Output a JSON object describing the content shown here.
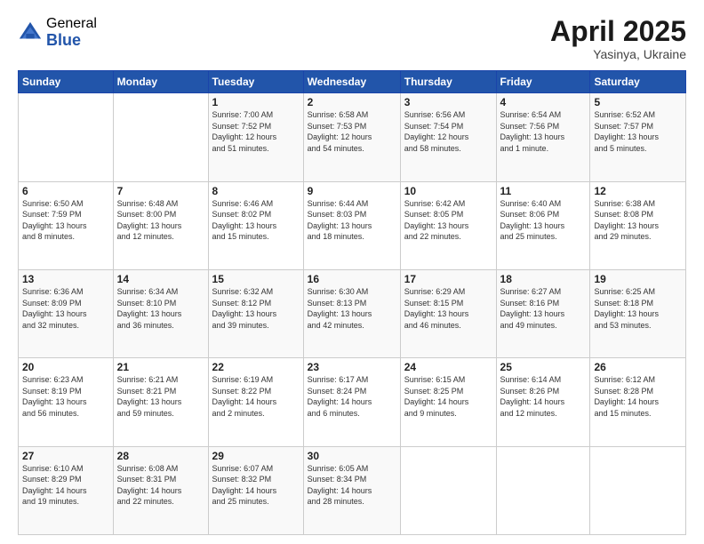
{
  "header": {
    "logo_general": "General",
    "logo_blue": "Blue",
    "month": "April 2025",
    "location": "Yasinya, Ukraine"
  },
  "days_of_week": [
    "Sunday",
    "Monday",
    "Tuesday",
    "Wednesday",
    "Thursday",
    "Friday",
    "Saturday"
  ],
  "weeks": [
    [
      {
        "day": "",
        "info": ""
      },
      {
        "day": "",
        "info": ""
      },
      {
        "day": "1",
        "info": "Sunrise: 7:00 AM\nSunset: 7:52 PM\nDaylight: 12 hours\nand 51 minutes."
      },
      {
        "day": "2",
        "info": "Sunrise: 6:58 AM\nSunset: 7:53 PM\nDaylight: 12 hours\nand 54 minutes."
      },
      {
        "day": "3",
        "info": "Sunrise: 6:56 AM\nSunset: 7:54 PM\nDaylight: 12 hours\nand 58 minutes."
      },
      {
        "day": "4",
        "info": "Sunrise: 6:54 AM\nSunset: 7:56 PM\nDaylight: 13 hours\nand 1 minute."
      },
      {
        "day": "5",
        "info": "Sunrise: 6:52 AM\nSunset: 7:57 PM\nDaylight: 13 hours\nand 5 minutes."
      }
    ],
    [
      {
        "day": "6",
        "info": "Sunrise: 6:50 AM\nSunset: 7:59 PM\nDaylight: 13 hours\nand 8 minutes."
      },
      {
        "day": "7",
        "info": "Sunrise: 6:48 AM\nSunset: 8:00 PM\nDaylight: 13 hours\nand 12 minutes."
      },
      {
        "day": "8",
        "info": "Sunrise: 6:46 AM\nSunset: 8:02 PM\nDaylight: 13 hours\nand 15 minutes."
      },
      {
        "day": "9",
        "info": "Sunrise: 6:44 AM\nSunset: 8:03 PM\nDaylight: 13 hours\nand 18 minutes."
      },
      {
        "day": "10",
        "info": "Sunrise: 6:42 AM\nSunset: 8:05 PM\nDaylight: 13 hours\nand 22 minutes."
      },
      {
        "day": "11",
        "info": "Sunrise: 6:40 AM\nSunset: 8:06 PM\nDaylight: 13 hours\nand 25 minutes."
      },
      {
        "day": "12",
        "info": "Sunrise: 6:38 AM\nSunset: 8:08 PM\nDaylight: 13 hours\nand 29 minutes."
      }
    ],
    [
      {
        "day": "13",
        "info": "Sunrise: 6:36 AM\nSunset: 8:09 PM\nDaylight: 13 hours\nand 32 minutes."
      },
      {
        "day": "14",
        "info": "Sunrise: 6:34 AM\nSunset: 8:10 PM\nDaylight: 13 hours\nand 36 minutes."
      },
      {
        "day": "15",
        "info": "Sunrise: 6:32 AM\nSunset: 8:12 PM\nDaylight: 13 hours\nand 39 minutes."
      },
      {
        "day": "16",
        "info": "Sunrise: 6:30 AM\nSunset: 8:13 PM\nDaylight: 13 hours\nand 42 minutes."
      },
      {
        "day": "17",
        "info": "Sunrise: 6:29 AM\nSunset: 8:15 PM\nDaylight: 13 hours\nand 46 minutes."
      },
      {
        "day": "18",
        "info": "Sunrise: 6:27 AM\nSunset: 8:16 PM\nDaylight: 13 hours\nand 49 minutes."
      },
      {
        "day": "19",
        "info": "Sunrise: 6:25 AM\nSunset: 8:18 PM\nDaylight: 13 hours\nand 53 minutes."
      }
    ],
    [
      {
        "day": "20",
        "info": "Sunrise: 6:23 AM\nSunset: 8:19 PM\nDaylight: 13 hours\nand 56 minutes."
      },
      {
        "day": "21",
        "info": "Sunrise: 6:21 AM\nSunset: 8:21 PM\nDaylight: 13 hours\nand 59 minutes."
      },
      {
        "day": "22",
        "info": "Sunrise: 6:19 AM\nSunset: 8:22 PM\nDaylight: 14 hours\nand 2 minutes."
      },
      {
        "day": "23",
        "info": "Sunrise: 6:17 AM\nSunset: 8:24 PM\nDaylight: 14 hours\nand 6 minutes."
      },
      {
        "day": "24",
        "info": "Sunrise: 6:15 AM\nSunset: 8:25 PM\nDaylight: 14 hours\nand 9 minutes."
      },
      {
        "day": "25",
        "info": "Sunrise: 6:14 AM\nSunset: 8:26 PM\nDaylight: 14 hours\nand 12 minutes."
      },
      {
        "day": "26",
        "info": "Sunrise: 6:12 AM\nSunset: 8:28 PM\nDaylight: 14 hours\nand 15 minutes."
      }
    ],
    [
      {
        "day": "27",
        "info": "Sunrise: 6:10 AM\nSunset: 8:29 PM\nDaylight: 14 hours\nand 19 minutes."
      },
      {
        "day": "28",
        "info": "Sunrise: 6:08 AM\nSunset: 8:31 PM\nDaylight: 14 hours\nand 22 minutes."
      },
      {
        "day": "29",
        "info": "Sunrise: 6:07 AM\nSunset: 8:32 PM\nDaylight: 14 hours\nand 25 minutes."
      },
      {
        "day": "30",
        "info": "Sunrise: 6:05 AM\nSunset: 8:34 PM\nDaylight: 14 hours\nand 28 minutes."
      },
      {
        "day": "",
        "info": ""
      },
      {
        "day": "",
        "info": ""
      },
      {
        "day": "",
        "info": ""
      }
    ]
  ]
}
